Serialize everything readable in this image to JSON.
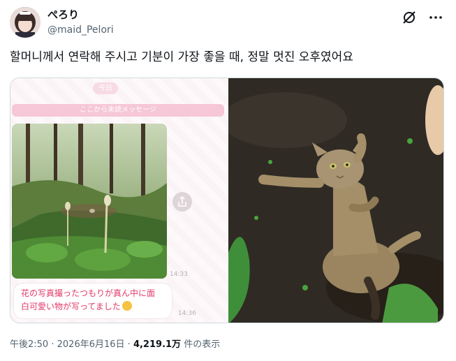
{
  "author": {
    "display_name": "ぺろり",
    "handle": "@maid_Pelori",
    "avatar_icon": "avatar-photo"
  },
  "header_icons": [
    "grok-icon",
    "more-icon"
  ],
  "tweet": {
    "text": "할머니께서 연락해 주시고 기분이 가장 좋을 때, 정말 멋진 오후였어요"
  },
  "chat_screenshot": {
    "date_label": "今日",
    "unread_label": "ここから未読メッセージ",
    "photo_time": "14:33",
    "message_line1": "花の写真撮ったつもりが真ん中に面",
    "message_line2": "白可愛い物が写ってました",
    "message_time": "14:36",
    "emoji_icon": "grinning-face-icon"
  },
  "meta": {
    "time": "午後2:50",
    "separator": "·",
    "date": "2026年6月16日",
    "views": "4,219.1万",
    "views_label": "件の表示"
  },
  "colors": {
    "text_primary": "#0f1419",
    "text_secondary": "#536471",
    "chat_pink": "#f6c7d6",
    "chat_text": "#e23a6a"
  }
}
